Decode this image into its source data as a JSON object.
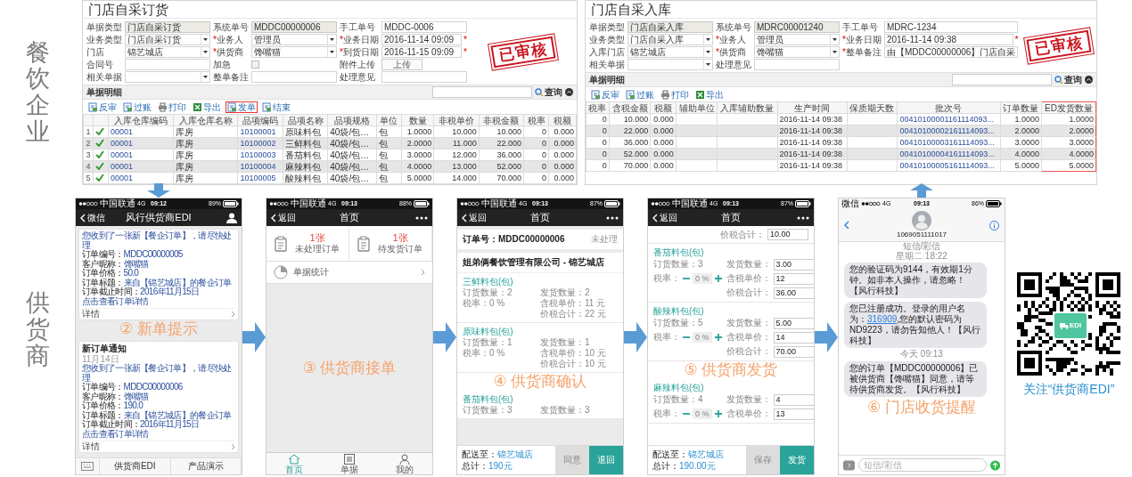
{
  "side_labels": [
    "餐饮企业",
    "供货商"
  ],
  "erp_windows": [
    {
      "title": "门店自采订货",
      "stamp": "已审核",
      "fields": [
        [
          {
            "label": "单据类型",
            "kind": "readonly",
            "value": "门店自采订货"
          },
          {
            "label": "系统单号",
            "kind": "readonly",
            "value": "MDDC00000006"
          },
          {
            "label": "手工单号",
            "kind": "text",
            "value": "MDDC-0006"
          }
        ],
        [
          {
            "label": "业务类型",
            "kind": "select",
            "value": "门店自采订货"
          },
          {
            "label": "业务人",
            "mark": "*",
            "kind": "select",
            "value": "管理员"
          },
          {
            "label": "业务日期",
            "mark": "*",
            "kind": "text",
            "value": "2016-11-14 09:09",
            "after": "*"
          }
        ],
        [
          {
            "label": "门店",
            "kind": "select",
            "value": "锦艺城店"
          },
          {
            "label": "供货商",
            "mark": "*",
            "kind": "select",
            "value": "馋嘴猫"
          },
          {
            "label": "到货日期",
            "mark": "*",
            "kind": "text",
            "value": "2016-11-15 09:09",
            "after": "*"
          }
        ],
        [
          {
            "label": "合同号",
            "kind": "text"
          },
          {
            "label": "加急",
            "kind": "checkbox",
            "checked": false
          },
          {
            "label": "附件上传",
            "kind": "button",
            "value": "上传"
          }
        ],
        [
          {
            "label": "相关单据",
            "kind": "select"
          },
          {
            "label": "整单备注",
            "kind": "text"
          },
          {
            "label": "处理意见",
            "kind": "text"
          }
        ]
      ],
      "section": "单据明细",
      "search_button": "查询",
      "toolbar": [
        {
          "label": "反审",
          "kind": "document",
          "highlighted": false
        },
        {
          "label": "过账",
          "kind": "document",
          "highlighted": false
        },
        {
          "label": "打印",
          "kind": "print",
          "highlighted": false
        },
        {
          "label": "导出",
          "kind": "export",
          "highlighted": false
        },
        {
          "label": "发单",
          "kind": "document",
          "highlighted": true
        },
        {
          "label": "结束",
          "kind": "document",
          "highlighted": false
        }
      ],
      "columns": [
        {
          "label": "入库仓库编码",
          "kind": "code",
          "highlighted": false
        },
        {
          "label": "入库仓库名称",
          "kind": "text",
          "highlighted": false
        },
        {
          "label": "品项编码",
          "kind": "code",
          "highlighted": false
        },
        {
          "label": "品项名称",
          "kind": "text",
          "highlighted": false
        },
        {
          "label": "品项规格",
          "kind": "text",
          "highlighted": false
        },
        {
          "label": "单位",
          "kind": "text",
          "highlighted": false
        },
        {
          "label": "数量",
          "kind": "number",
          "highlighted": false
        },
        {
          "label": "非税单价",
          "kind": "number",
          "highlighted": false
        },
        {
          "label": "非税金额",
          "kind": "number",
          "highlighted": false
        },
        {
          "label": "税率",
          "kind": "number",
          "highlighted": false
        },
        {
          "label": "税额",
          "kind": "number",
          "highlighted": false
        }
      ],
      "rows": [
        {
          "no": "1",
          "approved": true,
          "cells": [
            "00001",
            "库房",
            "10100001",
            "原味料包",
            "40袋/包…",
            "包",
            "1.0000",
            "10.000",
            "10.000",
            "0",
            "0.000"
          ]
        },
        {
          "no": "2",
          "approved": true,
          "cells": [
            "00001",
            "库房",
            "10100002",
            "三鲜料包",
            "40袋/包…",
            "包",
            "2.0000",
            "11.000",
            "22.000",
            "0",
            "0.000"
          ]
        },
        {
          "no": "3",
          "approved": true,
          "cells": [
            "00001",
            "库房",
            "10100003",
            "番茄料包",
            "40袋/包…",
            "包",
            "3.0000",
            "12.000",
            "36.000",
            "0",
            "0.000"
          ]
        },
        {
          "no": "4",
          "approved": true,
          "cells": [
            "00001",
            "库房",
            "10100004",
            "麻辣料包",
            "40袋/包…",
            "包",
            "4.0000",
            "13.000",
            "52.000",
            "0",
            "0.000"
          ]
        },
        {
          "no": "5",
          "approved": true,
          "cells": [
            "00001",
            "库房",
            "10100005",
            "酸辣料包",
            "40袋/包…",
            "包",
            "5.0000",
            "14.000",
            "70.000",
            "0",
            "0.000"
          ]
        }
      ]
    },
    {
      "title": "门店自采入库",
      "stamp": "已审核",
      "fields": [
        [
          {
            "label": "单据类型",
            "kind": "readonly",
            "value": "门店自采入库"
          },
          {
            "label": "系统单号",
            "kind": "readonly",
            "value": "MDRC00001240"
          },
          {
            "label": "手工单号",
            "kind": "text",
            "value": "MDRC-1234"
          }
        ],
        [
          {
            "label": "业务类型",
            "kind": "select",
            "value": "门店自采入库"
          },
          {
            "label": "业务人",
            "mark": "*",
            "kind": "select",
            "value": "管理员"
          },
          {
            "label": "业务日期",
            "mark": "*",
            "kind": "text",
            "value": "2016-11-14 09:38",
            "after": "*"
          }
        ],
        [
          {
            "label": "入库门店",
            "kind": "select",
            "value": "锦艺城店"
          },
          {
            "label": "供货商",
            "mark": "*",
            "kind": "select",
            "value": "馋嘴猫"
          },
          {
            "label": "整单备注",
            "mark": "*",
            "kind": "text",
            "value": "由【MDDC00000006】门店自采"
          }
        ],
        [
          {
            "label": "相关单据",
            "kind": "select"
          },
          {
            "label": "处理意见",
            "kind": "text"
          }
        ]
      ],
      "section": "单据明细",
      "search_button": "查询",
      "toolbar": [
        {
          "label": "反审",
          "kind": "document",
          "highlighted": false
        },
        {
          "label": "过账",
          "kind": "document",
          "highlighted": false
        },
        {
          "label": "打印",
          "kind": "print",
          "highlighted": false
        },
        {
          "label": "导出",
          "kind": "export",
          "highlighted": false
        }
      ],
      "columns": [
        {
          "label": "税率",
          "kind": "number",
          "highlighted": false
        },
        {
          "label": "含税金额",
          "kind": "number",
          "highlighted": false
        },
        {
          "label": "税额",
          "kind": "number",
          "highlighted": false
        },
        {
          "label": "辅助单位",
          "kind": "text",
          "highlighted": false
        },
        {
          "label": "入库辅助数量",
          "kind": "number",
          "highlighted": false
        },
        {
          "label": "生产时间",
          "kind": "date",
          "highlighted": false
        },
        {
          "label": "保质期天数",
          "kind": "number",
          "highlighted": false
        },
        {
          "label": "批次号",
          "kind": "code",
          "highlighted": false
        },
        {
          "label": "订单数量",
          "kind": "number",
          "highlighted": false
        },
        {
          "label": "ED发货数量",
          "kind": "number",
          "highlighted": true
        }
      ],
      "rows": [
        {
          "cells": [
            "0",
            "10.000",
            "0.000",
            null,
            null,
            "2016-11-14 09:38",
            null,
            "00410100001161114093...",
            "1.0000",
            "1.0000"
          ]
        },
        {
          "cells": [
            "0",
            "22.000",
            "0.000",
            null,
            null,
            "2016-11-14 09:38",
            null,
            "00410100002161114093...",
            "2.0000",
            "2.0000"
          ]
        },
        {
          "cells": [
            "0",
            "36.000",
            "0.000",
            null,
            null,
            "2016-11-14 09:38",
            null,
            "00410100003161114093...",
            "3.0000",
            "3.0000"
          ]
        },
        {
          "cells": [
            "0",
            "52.000",
            "0.000",
            null,
            null,
            "2016-11-14 09:38",
            null,
            "00410100004161114093...",
            "4.0000",
            "4.0000"
          ]
        },
        {
          "cells": [
            "0",
            "70.000",
            "0.000",
            null,
            null,
            "2016-11-14 09:38",
            null,
            "00410100005161114093...",
            "5.0000",
            "5.0000"
          ]
        }
      ]
    }
  ],
  "phones": [
    {
      "kind": "wechat",
      "status": {
        "carrier": "中国联通",
        "network": "4G",
        "time": "09:12",
        "battery": "89%"
      },
      "nav": {
        "back": "微信",
        "title": "风行供货商EDI"
      },
      "content": [
        {
          "kind": "card",
          "lines": [
            {
              "value": "您收到了一张新【餐企订单】，请尽快处理"
            },
            {
              "label": "订单编号：",
              "value": "MDDC00000005"
            },
            {
              "label": "客户昵称：",
              "value": "馋嘴猫"
            },
            {
              "label": "订单价格：",
              "value": "50.0"
            },
            {
              "label": "订单标题：",
              "value": "来自【锦艺城店】的餐企订单"
            },
            {
              "label": "订单截止时间：",
              "value": "2016年11月15日"
            },
            {
              "value": "点击查看订单详情"
            }
          ],
          "footer": "详情"
        },
        {
          "kind": "caption",
          "text": "② 新单提示"
        },
        {
          "kind": "card",
          "title": "新订单通知",
          "date": "11月14日",
          "lines": [
            {
              "value": "您收到了一张新【餐企订单】，请尽快处理"
            },
            {
              "label": "订单编号：",
              "value": "MDDC00000006"
            },
            {
              "label": "客户昵称：",
              "value": "馋嘴猫"
            },
            {
              "label": "订单价格：",
              "value": "190.0"
            },
            {
              "label": "订单标题：",
              "value": "来自【锦艺城店】的餐企订单"
            },
            {
              "label": "订单截止时间：",
              "value": "2016年11月15日"
            },
            {
              "value": "点击查看订单详情"
            }
          ],
          "footer": "详情"
        }
      ],
      "menu": [
        "供货商EDI",
        "产品演示"
      ]
    },
    {
      "kind": "home",
      "status": {
        "carrier": "中国联通",
        "network": "4G",
        "time": "09:13",
        "battery": "88%"
      },
      "nav": {
        "back": "返回",
        "title": "首页"
      },
      "tiles": [
        {
          "count": "1张",
          "label": "未处理订单"
        },
        {
          "count": "1张",
          "label": "待发货订单"
        }
      ],
      "stats": "单据统计",
      "caption": "③ 供货商接单",
      "tabs": [
        {
          "label": "首页",
          "kind": "home",
          "selected": true
        },
        {
          "label": "单据",
          "kind": "list",
          "selected": false
        },
        {
          "label": "我的",
          "kind": "person",
          "selected": false
        }
      ]
    },
    {
      "kind": "confirm",
      "status": {
        "carrier": "中国联通",
        "network": "4G",
        "time": "09:13",
        "battery": "87%"
      },
      "nav": {
        "back": "返回",
        "title": "首页"
      },
      "order": {
        "label": "订单号：",
        "value": "MDDC00000006",
        "status": "未处理"
      },
      "company": "姐弟俩餐饮管理有限公司 - 锦艺城店",
      "content": [
        {
          "kind": "item",
          "name": "三鲜料包(包)",
          "left": [
            "订货数量：2",
            "税率：0 %"
          ],
          "right": [
            "发货数量：2",
            "含税单价：11 元",
            "价税合计：22 元"
          ]
        },
        {
          "kind": "item",
          "name": "原味料包(包)",
          "left": [
            "订货数量：1",
            "税率：0 %"
          ],
          "right": [
            "发货数量：1",
            "含税单价：10 元",
            "价税合计：10 元"
          ]
        },
        {
          "kind": "caption",
          "text": "④ 供货商确认"
        },
        {
          "kind": "item",
          "name": "番茄料包(包)",
          "left": [
            "订货数量：3"
          ],
          "right": [
            "发货数量：3"
          ]
        }
      ],
      "footer": {
        "ship_label": "配送至：",
        "ship_to": "锦艺城店",
        "total_label": "总计：",
        "total": "190元",
        "buttons": [
          {
            "label": "同意",
            "kind": "secondary"
          },
          {
            "label": "退回",
            "kind": "primary"
          }
        ]
      }
    },
    {
      "kind": "ship",
      "status": {
        "carrier": "中国联通",
        "network": "4G",
        "time": "09:13",
        "battery": "87%"
      },
      "nav": {
        "back": "返回",
        "title": "首页"
      },
      "content": [
        {
          "kind": "total",
          "label": "价税合计：",
          "value": "10.00"
        },
        {
          "kind": "item",
          "name": "番茄料包(包)",
          "ordered": "订货数量：3",
          "tax_label": "税率：",
          "tax": "0 %",
          "inputs": [
            {
              "label": "发货数量：",
              "value": "3.00"
            },
            {
              "label": "含税单价：",
              "value": "12"
            },
            {
              "label": "价税合计：",
              "value": "36.00"
            }
          ]
        },
        {
          "kind": "item",
          "name": "酸辣料包(包)",
          "ordered": "订货数量：5",
          "tax_label": "税率：",
          "tax": "0 %",
          "inputs": [
            {
              "label": "发货数量：",
              "value": "5.00"
            },
            {
              "label": "含税单价：",
              "value": "14"
            },
            {
              "label": "价税合计：",
              "value": "70.00"
            }
          ]
        },
        {
          "kind": "caption",
          "text": "⑤ 供货商发货"
        },
        {
          "kind": "item",
          "name": "麻辣料包(包)",
          "ordered": "订货数量：4",
          "tax_label": "税率：",
          "tax": "0 %",
          "inputs": [
            {
              "label": "发货数量：",
              "value": "4"
            },
            {
              "label": "含税单价：",
              "value": "13"
            }
          ]
        }
      ],
      "footer": {
        "ship_label": "配送至：",
        "ship_to": "锦艺城店",
        "total_label": "总计：",
        "total": "190.00元",
        "buttons": [
          {
            "label": "保存",
            "kind": "secondary"
          },
          {
            "label": "发货",
            "kind": "primary"
          }
        ]
      }
    },
    {
      "kind": "sms",
      "status": {
        "app": "微信",
        "network": "4G",
        "time": "09:13",
        "battery": "86%"
      },
      "contact": "1069051111017",
      "content": [
        {
          "kind": "time",
          "lines": [
            "短信/彩信",
            "星期二 18:22"
          ]
        },
        {
          "kind": "bubble",
          "parts": [
            {
              "text": "您的验证码为9144，有效期1分钟。如非本人操作，请忽略！【风行科技】",
              "link": false
            }
          ]
        },
        {
          "kind": "bubble",
          "parts": [
            {
              "text": "您已注册成功。登录的用户名为：",
              "link": false
            },
            {
              "text": "316909",
              "link": true
            },
            {
              "text": ",您的默认密码为ND9223，请勿告知他人！【风行科技】",
              "link": false
            }
          ]
        },
        {
          "kind": "time",
          "lines": [
            "今天 09:13"
          ]
        },
        {
          "kind": "bubble",
          "parts": [
            {
              "text": "您的订单【MDDC00000006】已被供货商【馋嘴猫】同意，请等待供货商发货。【风行科技】",
              "link": false
            }
          ]
        },
        {
          "kind": "caption",
          "text": "⑥ 门店收货提醒"
        }
      ],
      "placeholder": "短信/彩信"
    }
  ],
  "qr": {
    "logo_text": "EDI",
    "caption": "关注“供货商EDI”"
  }
}
